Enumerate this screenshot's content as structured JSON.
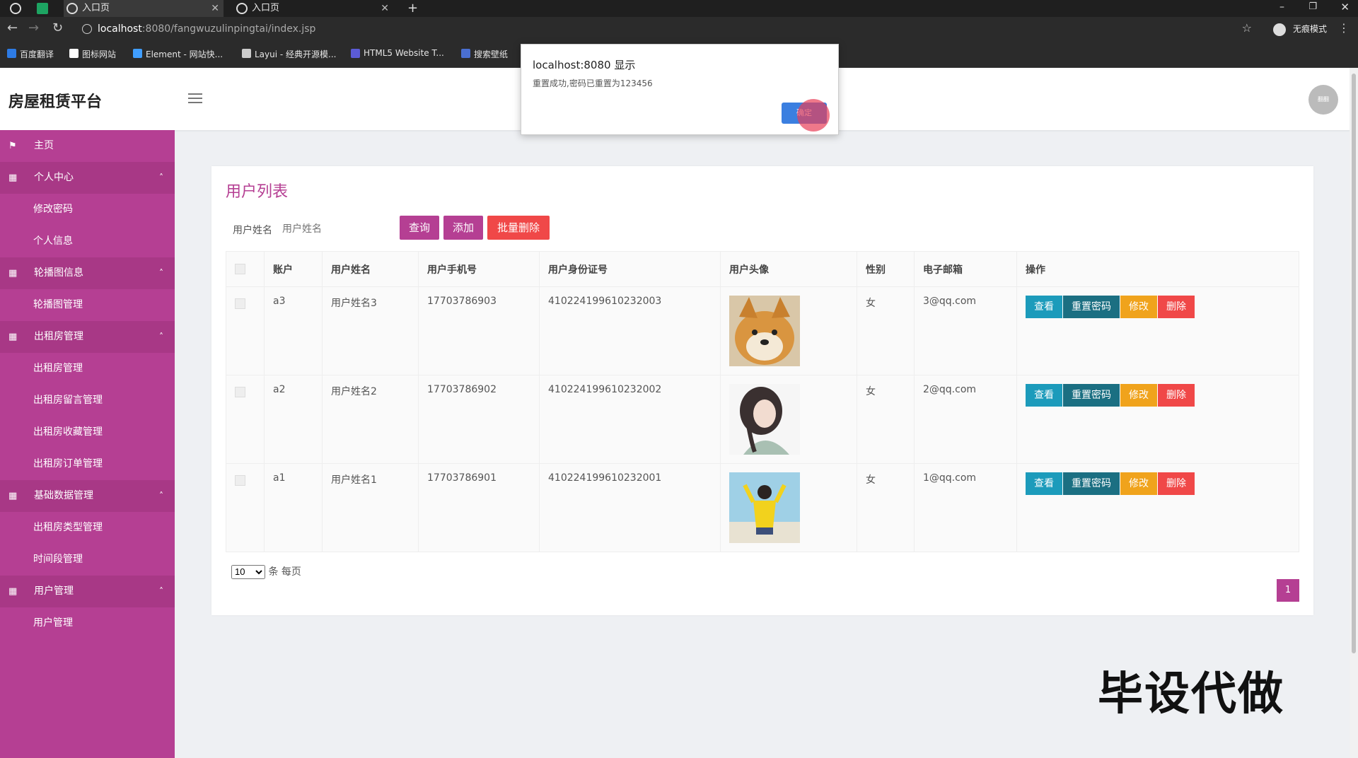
{
  "browser": {
    "tabs": [
      {
        "label": "入口页"
      },
      {
        "label": "入口页"
      }
    ],
    "url_host": "localhost",
    "url_path": ":8080/fangwuzulinpingtai/index.jsp",
    "incognito_label": "无痕模式",
    "bookmarks": [
      {
        "label": "百度翻译",
        "color": "#2d7be5"
      },
      {
        "label": "图标网站",
        "color": "#ffffff"
      },
      {
        "label": "Element - 网站快...",
        "color": "#409eff"
      },
      {
        "label": "Layui - 经典开源模...",
        "color": "#cccccc"
      },
      {
        "label": "HTML5 Website T...",
        "color": "#5b5bd6"
      },
      {
        "label": "搜索壁纸",
        "color": "#4a6fd1"
      }
    ]
  },
  "app": {
    "brand": "房屋租赁平台",
    "avatar_text": "翻翻"
  },
  "sidebar": {
    "items": [
      {
        "label": "主页",
        "type": "top"
      },
      {
        "label": "个人中心",
        "type": "group"
      },
      {
        "label": "修改密码",
        "type": "sub"
      },
      {
        "label": "个人信息",
        "type": "sub"
      },
      {
        "label": "轮播图信息",
        "type": "group"
      },
      {
        "label": "轮播图管理",
        "type": "sub"
      },
      {
        "label": "出租房管理",
        "type": "group"
      },
      {
        "label": "出租房管理",
        "type": "sub"
      },
      {
        "label": "出租房留言管理",
        "type": "sub"
      },
      {
        "label": "出租房收藏管理",
        "type": "sub"
      },
      {
        "label": "出租房订单管理",
        "type": "sub"
      },
      {
        "label": "基础数据管理",
        "type": "group"
      },
      {
        "label": "出租房类型管理",
        "type": "sub"
      },
      {
        "label": "时间段管理",
        "type": "sub"
      },
      {
        "label": "用户管理",
        "type": "group"
      },
      {
        "label": "用户管理",
        "type": "sub"
      }
    ]
  },
  "main": {
    "title": "用户列表",
    "search_label": "用户姓名",
    "search_placeholder": "用户姓名",
    "query_button": "查询",
    "add_button": "添加",
    "batch_delete_button": "批量删除",
    "columns": [
      "账户",
      "用户姓名",
      "用户手机号",
      "用户身份证号",
      "用户头像",
      "性别",
      "电子邮箱",
      "操作"
    ],
    "rows": [
      {
        "account": "a3",
        "name": "用户姓名3",
        "phone": "17703786903",
        "idcard": "410224199610232003",
        "gender": "女",
        "email": "3@qq.com",
        "avatar": "shiba"
      },
      {
        "account": "a2",
        "name": "用户姓名2",
        "phone": "17703786902",
        "idcard": "410224199610232002",
        "gender": "女",
        "email": "2@qq.com",
        "avatar": "girl-illustration"
      },
      {
        "account": "a1",
        "name": "用户姓名1",
        "phone": "17703786901",
        "idcard": "410224199610232001",
        "gender": "女",
        "email": "1@qq.com",
        "avatar": "girl-yellow"
      }
    ],
    "actions": {
      "view": "查看",
      "reset": "重置密码",
      "edit": "修改",
      "delete": "删除"
    },
    "page_size": "10",
    "page_size_suffix": "条 每页",
    "current_page": "1"
  },
  "dialog": {
    "title": "localhost:8080 显示",
    "message": "重置成功,密码已重置为123456",
    "ok_button": "确定"
  },
  "watermark": "毕设代做"
}
